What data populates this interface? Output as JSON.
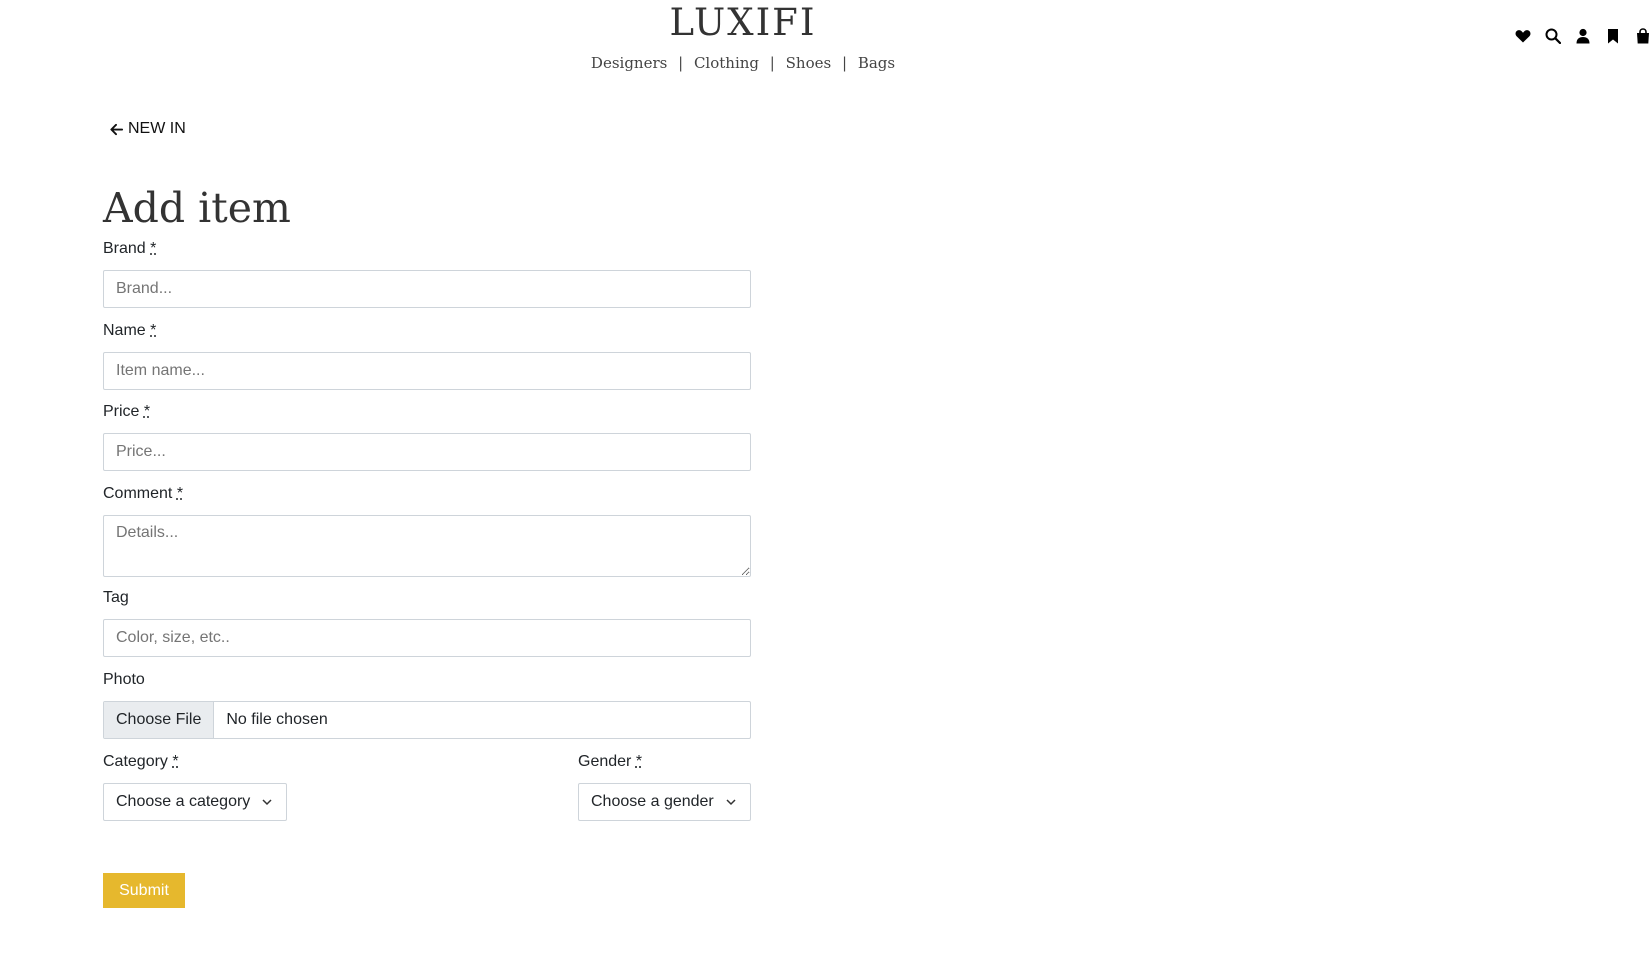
{
  "header": {
    "logo": "LUXIFI",
    "nav": [
      "Designers",
      "Clothing",
      "Shoes",
      "Bags"
    ],
    "separator": "|",
    "icons": [
      "heart-icon",
      "search-icon",
      "user-icon",
      "bookmark-icon",
      "shopping-bag-icon"
    ]
  },
  "back_link": {
    "label": "NEW IN"
  },
  "page_title": "Add item",
  "form": {
    "required_marker": "*",
    "brand": {
      "label": "Brand",
      "placeholder": "Brand..."
    },
    "name": {
      "label": "Name",
      "placeholder": "Item name..."
    },
    "price": {
      "label": "Price",
      "placeholder": "Price..."
    },
    "comment": {
      "label": "Comment",
      "placeholder": "Details..."
    },
    "tag": {
      "label": "Tag",
      "placeholder": "Color, size, etc.."
    },
    "photo": {
      "label": "Photo",
      "button": "Choose File",
      "status": "No file chosen"
    },
    "category": {
      "label": "Category",
      "selected": "Choose a category"
    },
    "gender": {
      "label": "Gender",
      "selected": "Choose a gender"
    },
    "submit_label": "Submit"
  },
  "colors": {
    "submit_bg": "#e6b82d",
    "text": "#212529",
    "border": "#ced4da"
  }
}
